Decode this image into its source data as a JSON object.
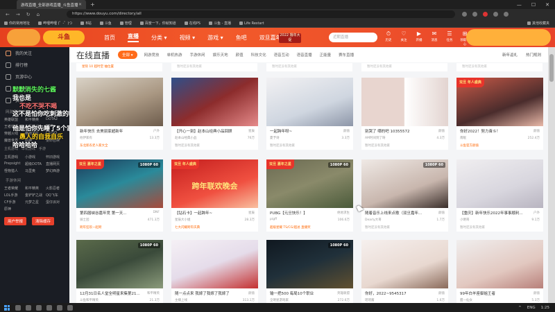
{
  "browser": {
    "tab_title": "游戏直播_全部游戏直播_斗鱼直播",
    "url": "https://www.douyu.com/directory/all",
    "bookmarks": [
      "你的常用地址",
      "哔哩哔哩 (゜-゜)つ",
      "B站",
      "斗鱼",
      "管理",
      "百度一下，你就知道",
      "在线PS",
      "斗鱼 - 直播",
      "Life Restart"
    ],
    "bookmark_right": "其他收藏夹"
  },
  "site_header": {
    "logo": "斗鱼",
    "nav": [
      "首页",
      "直播",
      "分类 ▾",
      "视频 ▾",
      "游戏 ▾",
      "鱼吧",
      "双旦嘉年回"
    ],
    "promo": "2022 撸年大促",
    "search_placeholder": "近期直播",
    "icons": [
      {
        "glyph": "⏱",
        "label": "历史"
      },
      {
        "glyph": "♡",
        "label": "关注"
      },
      {
        "glyph": "▶",
        "label": "开播"
      },
      {
        "glyph": "✉",
        "label": "消息"
      },
      {
        "glyph": "☰",
        "label": "任务"
      },
      {
        "glyph": "⊞",
        "label": "领取中心"
      }
    ]
  },
  "sidebar": {
    "items": [
      "我的关注",
      "排行榜",
      "页游中心",
      "云游戏",
      "赛事"
    ],
    "section_hot": "网游竞技",
    "hot_grid": [
      "英雄联盟",
      "和平精英",
      "DOTA2",
      "王者荣耀",
      "主机游戏",
      "DNF",
      "穿越火线",
      "绝地求生",
      "CS:GO",
      "魔兽世界",
      "原神",
      "使命召唤"
    ],
    "section_tabs": [
      "主机游戏",
      "单机游戏",
      "手游"
    ],
    "hot_grid2": [
      "主机游戏",
      "小游戏",
      "怀旧游戏",
      "Prepsight",
      "超级DOTA",
      "直播网页",
      "怪物猎人",
      "马里奥",
      "梦幻西游"
    ],
    "section_mobile": "手游休闲",
    "mobile_grid": [
      "王者荣耀",
      "和平精英",
      "火影忍者",
      "LOL手游",
      "金铲铲之战",
      "QQ飞车",
      "CF手游",
      "元梦之星",
      "蛋仔派对",
      "原神"
    ],
    "buttons": [
      "用户举报",
      "清除缓存"
    ],
    "danmaku": [
      {
        "text": "默默消失的七酱",
        "color": "#5cf15c"
      },
      {
        "text": "我也是",
        "color": "#ffffff"
      },
      {
        "text": "不吃不哭不喝",
        "color": "#ff7474"
      },
      {
        "text": "这不是怕你吃刺激的吗",
        "color": "#ffffff"
      },
      {
        "text": "他是怕你先睡了5个家族吗",
        "color": "#ffffff"
      },
      {
        "text": "愚人的自我自乐",
        "color": "#ffd21a"
      },
      {
        "text": "哈哈哈哈",
        "color": "#ffffff"
      }
    ]
  },
  "main": {
    "title": "在线直播",
    "all_label": "全部 ▾",
    "categories": [
      "网游竞技",
      "单机热游",
      "手游休闲",
      "娱乐天地",
      "颜值",
      "科技文化",
      "语音互动",
      "语音直播",
      "正能量",
      "赛车直播"
    ],
    "tools": [
      "新年返礼",
      "热门规则"
    ],
    "row0": [
      {
        "tag": "星际 10 超时空 抽位置",
        "sub": "暂时还没有其他家"
      },
      {
        "tag": "",
        "sub": "暂时还没有其他家"
      },
      {
        "tag": "",
        "sub": "暂时还没有其他家"
      },
      {
        "tag": "",
        "sub": "暂时还没有其他家"
      },
      {
        "tag": "",
        "sub": "暂时还没有其他家"
      }
    ],
    "cards": [
      {
        "title": "新年快乐 去美丽家超新年",
        "cat": "户外",
        "streamer": "他伊家有",
        "views": "13.3万",
        "tag": "东北新农老人家大全",
        "tag_gray": false
      },
      {
        "title": "【开心一刻】赵本山经典小品回顾",
        "cat": "星辰",
        "streamer": "赵本山经典小品",
        "views": "76万",
        "tag": "暂时还没有其他家",
        "tag_gray": true
      },
      {
        "title": "一起跨年呀~",
        "cat": "颜值",
        "streamer": "夏予诗",
        "views": "3.3万",
        "tag": "暂时还没有其他家",
        "tag_gray": true
      },
      {
        "title": "别哭了 哪的吧 10355572",
        "cat": "颜值",
        "streamer": "AM时间到了呀",
        "views": "4.3万",
        "tag": "暂时还没有其他家",
        "tag_gray": true
      },
      {
        "title": "你好2022！努力奋斗！",
        "cat": "颜值",
        "streamer": "南眠",
        "views": "252.4万",
        "tag": "斗鱼官方颜值",
        "tag_gray": false
      },
      {
        "title": "第四届峡谷嘉年竞 第一天...",
        "cat": "DNF",
        "streamer": "骑士团",
        "views": "471.3万",
        "tag": "跨年狂欢一起跨",
        "tag_gray": false
      },
      {
        "title": "【钻石卡】一起跨年~",
        "cat": "星辰",
        "streamer": "星辰大小姐",
        "views": "28.3万",
        "tag": "七大闪耀跨年庆典",
        "tag_gray": false
      },
      {
        "title": "PUBG【元旦快乐！】",
        "cat": "绝地求生",
        "streamer": "pigff",
        "views": "106.6万",
        "tag": "超级星耀 TS/CG/超总 直播奖",
        "tag_gray": false
      },
      {
        "title": "随着音乐上线来点歌（双旦嘉年...",
        "cat": "颜值",
        "streamer": "Dearly大哥",
        "views": "1.7万",
        "tag": "暂时还没有其他家",
        "tag_gray": true
      },
      {
        "title": "【重庆】新年快乐2022年事事顺利...",
        "cat": "户外",
        "streamer": "小明哥",
        "views": "9.1万",
        "tag": "暂时还没有其他家",
        "tag_gray": true
      },
      {
        "title": "12月31日名人堂全明星来集第21...",
        "cat": "和平精英",
        "streamer": "斗鱼和平精英",
        "views": "21.3万",
        "tag": "",
        "tag_gray": true
      },
      {
        "title": "随一点点来 我嫁了我嫁了我嫁了",
        "cat": "颜值",
        "streamer": "主播上线",
        "views": "313.1万",
        "tag": "",
        "tag_gray": true
      },
      {
        "title": "输一把500 每局10个职业",
        "cat": "英雄联盟",
        "streamer": "全明星游戏家",
        "views": "272.6万",
        "tag": "",
        "tag_gray": true
      },
      {
        "title": "你好，2022~9545317",
        "cat": "颜值",
        "streamer": "瑶瑶酱",
        "views": "1.6万",
        "tag": "",
        "tag_gray": true
      },
      {
        "title": "99年白羊座御姐王者",
        "cat": "颜值",
        "streamer": "甜一仙女",
        "views": "5.3万",
        "tag": "",
        "tag_gray": true
      }
    ],
    "badge_1080": "1080P 60",
    "ribbons": [
      "双旦 嘉年之星",
      "双旦 年人盛典"
    ],
    "overlay_stage": "跨年联欢晚会"
  },
  "taskbar": {
    "tray": [
      "^",
      "ENG",
      "1:25"
    ]
  }
}
